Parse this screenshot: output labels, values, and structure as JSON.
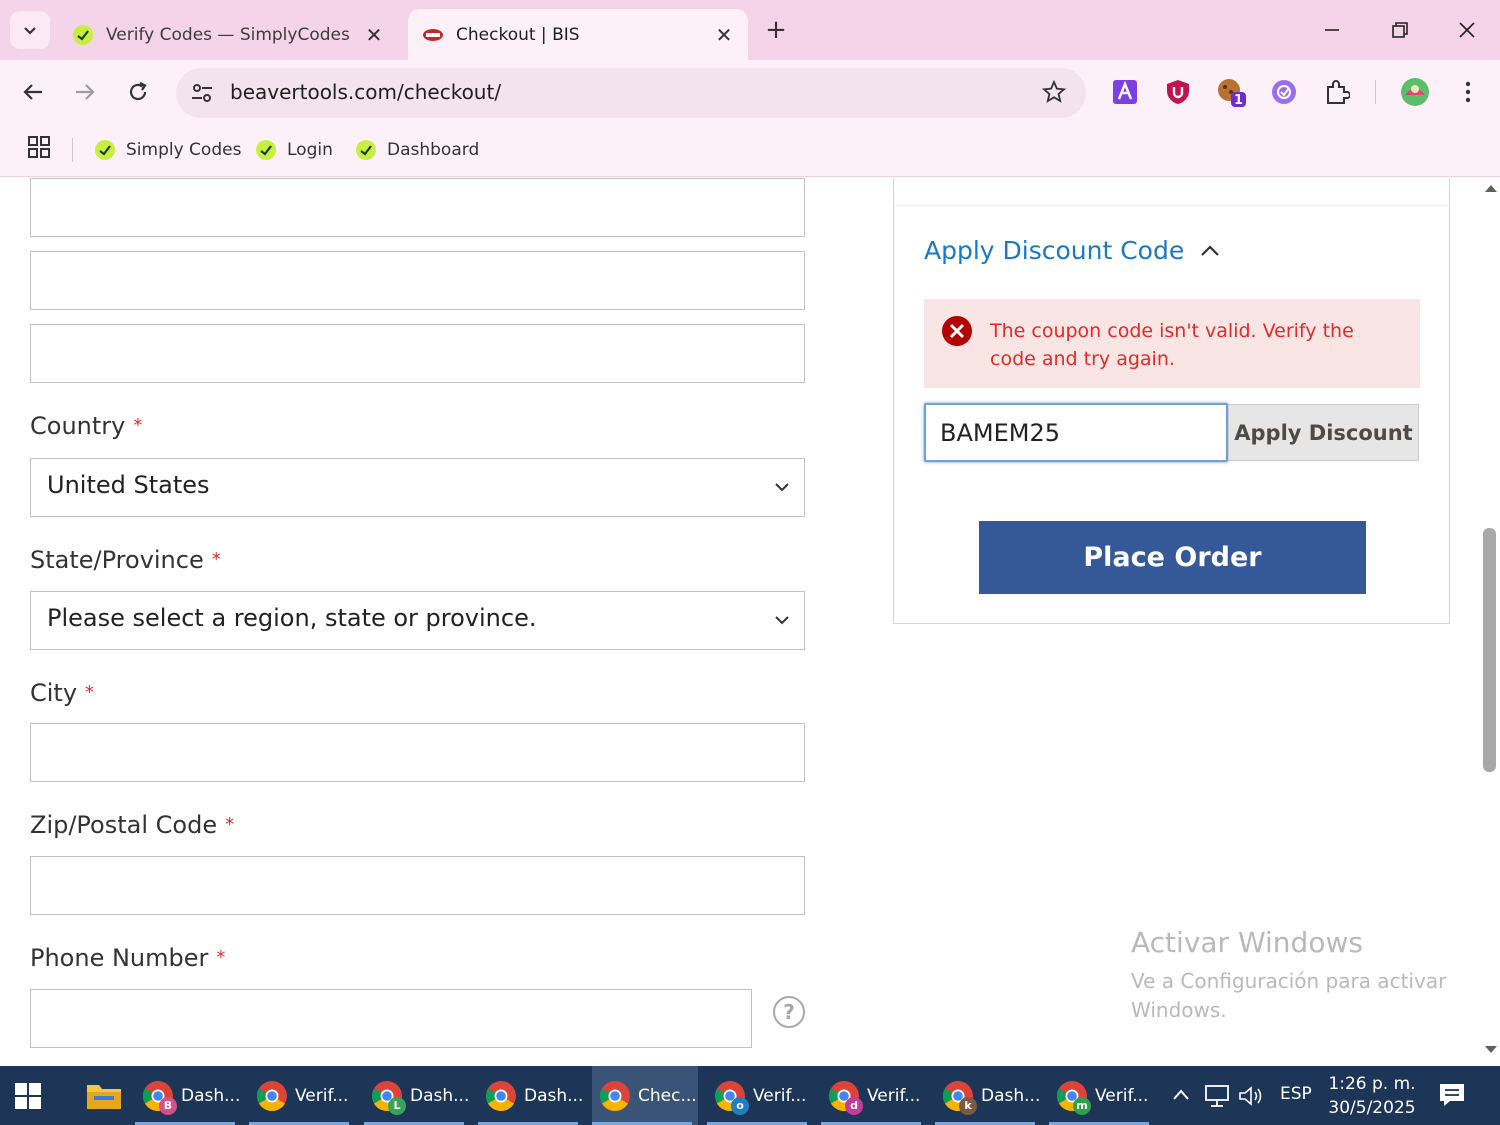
{
  "browser": {
    "tabs": [
      {
        "title": "Verify Codes — SimplyCodes",
        "active": false
      },
      {
        "title": "Checkout | BIS",
        "active": true
      }
    ],
    "url": "beavertools.com/checkout/",
    "bookmarks": [
      {
        "label": "Simply Codes"
      },
      {
        "label": "Login"
      },
      {
        "label": "Dashboard"
      }
    ],
    "extension_badge": "1"
  },
  "form": {
    "country": {
      "label": "Country",
      "required_mark": "*",
      "value": "United States"
    },
    "state": {
      "label": "State/Province",
      "required_mark": "*",
      "value": "Please select a region, state or province."
    },
    "city": {
      "label": "City",
      "required_mark": "*"
    },
    "zip": {
      "label": "Zip/Postal Code",
      "required_mark": "*"
    },
    "phone": {
      "label": "Phone Number",
      "required_mark": "*"
    },
    "help_glyph": "?"
  },
  "discount": {
    "toggle_label": "Apply Discount Code",
    "error_message": "The coupon code isn't valid. Verify the code and try again.",
    "code_value": "BAMEM25",
    "apply_label": "Apply Discount",
    "place_order_label": "Place Order"
  },
  "watermark": {
    "line1": "Activar Windows",
    "line2": "Ve a Configuración para activar Windows."
  },
  "taskbar": {
    "items": [
      {
        "label": "Dash...",
        "badge": "B",
        "badge_color": "#d64e8a"
      },
      {
        "label": "Verif...",
        "badge": "",
        "badge_color": ""
      },
      {
        "label": "Dash...",
        "badge": "L",
        "badge_color": "#3aa35a"
      },
      {
        "label": "Dash...",
        "badge": "",
        "badge_color": ""
      },
      {
        "label": "Chec...",
        "badge": "",
        "badge_color": "",
        "active": true
      },
      {
        "label": "Verif...",
        "badge": "o",
        "badge_color": "#1f7fc4"
      },
      {
        "label": "Verif...",
        "badge": "d",
        "badge_color": "#c33c9b"
      },
      {
        "label": "Dash...",
        "badge": "k",
        "badge_color": "#7a5a44"
      },
      {
        "label": "Verif...",
        "badge": "m",
        "badge_color": "#2f9f4a"
      }
    ],
    "language": "ESP",
    "time": "1:26 p. m.",
    "date": "30/5/2025"
  },
  "colors": {
    "accent_link": "#1979c3",
    "error_text": "#e02b27",
    "error_bg": "#fae5e5",
    "primary_button": "#345898",
    "tabstrip": "#f5d4e9",
    "taskbar": "#1d3557"
  }
}
